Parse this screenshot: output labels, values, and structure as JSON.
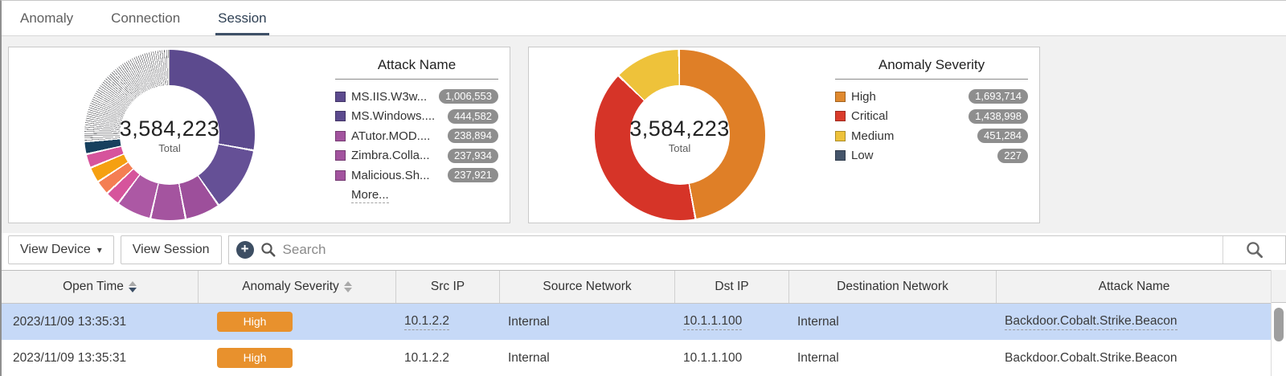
{
  "tabs": [
    {
      "label": "Anomaly",
      "active": false
    },
    {
      "label": "Connection",
      "active": false
    },
    {
      "label": "Session",
      "active": true
    }
  ],
  "chart_data": [
    {
      "type": "donut",
      "title": "Attack Name",
      "total": 3584223,
      "center_label": "3,584,223",
      "center_sublabel": "Total",
      "legend": [
        {
          "label": "MS.IIS.W3w...",
          "value": 1006553,
          "value_label": "1,006,553",
          "color": "#5C4A8E"
        },
        {
          "label": "MS.Windows....",
          "value": 444582,
          "value_label": "444,582",
          "color": "#5C4A8E"
        },
        {
          "label": "ATutor.MOD....",
          "value": 238894,
          "value_label": "238,894",
          "color": "#A2539E"
        },
        {
          "label": "Zimbra.Colla...",
          "value": 237934,
          "value_label": "237,934",
          "color": "#A2539E"
        },
        {
          "label": "Malicious.Sh...",
          "value": 237921,
          "value_label": "237,921",
          "color": "#A2539E"
        }
      ],
      "more_label": "More...",
      "slices": [
        {
          "name": "MS.IIS.W3w...",
          "value": 1006553,
          "color": "#5C4A8E"
        },
        {
          "name": "MS.Windows....",
          "value": 444582,
          "color": "#655096"
        },
        {
          "name": "ATutor.MOD....",
          "value": 238894,
          "color": "#9D4F9B"
        },
        {
          "name": "Zimbra.Colla...",
          "value": 237934,
          "color": "#A4549F"
        },
        {
          "name": "Malicious.Sh...",
          "value": 237921,
          "color": "#AC58A4"
        },
        {
          "name": "unlabeled-slice-1",
          "value": 100000,
          "color": "#D6549C",
          "estimated": true
        },
        {
          "name": "unlabeled-slice-2",
          "value": 98000,
          "color": "#F47E53",
          "estimated": true
        },
        {
          "name": "unlabeled-slice-3",
          "value": 106000,
          "color": "#F5A011",
          "estimated": true
        },
        {
          "name": "unlabeled-slice-4",
          "value": 95000,
          "color": "#D6549C",
          "estimated": true
        },
        {
          "name": "unlabeled-slice-5",
          "value": 86000,
          "color": "#16405E",
          "estimated": true
        },
        {
          "name": "remaining-small-slices",
          "value": 933339,
          "fan": true,
          "estimated": true
        }
      ]
    },
    {
      "type": "donut",
      "title": "Anomaly Severity",
      "total": 3584223,
      "center_label": "3,584,223",
      "center_sublabel": "Total",
      "legend": [
        {
          "label": "High",
          "value": 1693714,
          "value_label": "1,693,714",
          "color": "#E0892E"
        },
        {
          "label": "Critical",
          "value": 1438998,
          "value_label": "1,438,998",
          "color": "#DA3B2B"
        },
        {
          "label": "Medium",
          "value": 451284,
          "value_label": "451,284",
          "color": "#EEC23A"
        },
        {
          "label": "Low",
          "value": 227,
          "value_label": "227",
          "color": "#44546A"
        }
      ],
      "slices": [
        {
          "name": "High",
          "value": 1693714,
          "color": "#DF7F27"
        },
        {
          "name": "Critical",
          "value": 1438998,
          "color": "#D63428"
        },
        {
          "name": "Medium",
          "value": 451284,
          "color": "#EEC23A"
        },
        {
          "name": "Low",
          "value": 227,
          "color": "#44546A"
        }
      ]
    }
  ],
  "toolbar": {
    "view_device_label": "View Device",
    "view_device_caret": "▾",
    "view_session_label": "View Session",
    "add_filter_icon": "+",
    "search_placeholder": "Search",
    "search_value": ""
  },
  "table": {
    "columns": [
      {
        "label": "Open Time",
        "sort": "desc"
      },
      {
        "label": "Anomaly Severity",
        "sort": "unsorted"
      },
      {
        "label": "Src IP",
        "sort": null
      },
      {
        "label": "Source Network",
        "sort": null
      },
      {
        "label": "Dst IP",
        "sort": null
      },
      {
        "label": "Destination Network",
        "sort": null
      },
      {
        "label": "Attack Name",
        "sort": null
      }
    ],
    "severity_colors": {
      "High": "#E8912D"
    },
    "rows": [
      {
        "open_time": "2023/11/09 13:35:31",
        "severity": "High",
        "src_ip": "10.1.2.2",
        "source_network": "Internal",
        "dst_ip": "10.1.1.100",
        "destination_network": "Internal",
        "attack_name": "Backdoor.Cobalt.Strike.Beacon",
        "selected": true,
        "drilldown": true
      },
      {
        "open_time": "2023/11/09 13:35:31",
        "severity": "High",
        "src_ip": "10.1.2.2",
        "source_network": "Internal",
        "dst_ip": "10.1.1.100",
        "destination_network": "Internal",
        "attack_name": "Backdoor.Cobalt.Strike.Beacon",
        "selected": false,
        "drilldown": false
      }
    ]
  }
}
